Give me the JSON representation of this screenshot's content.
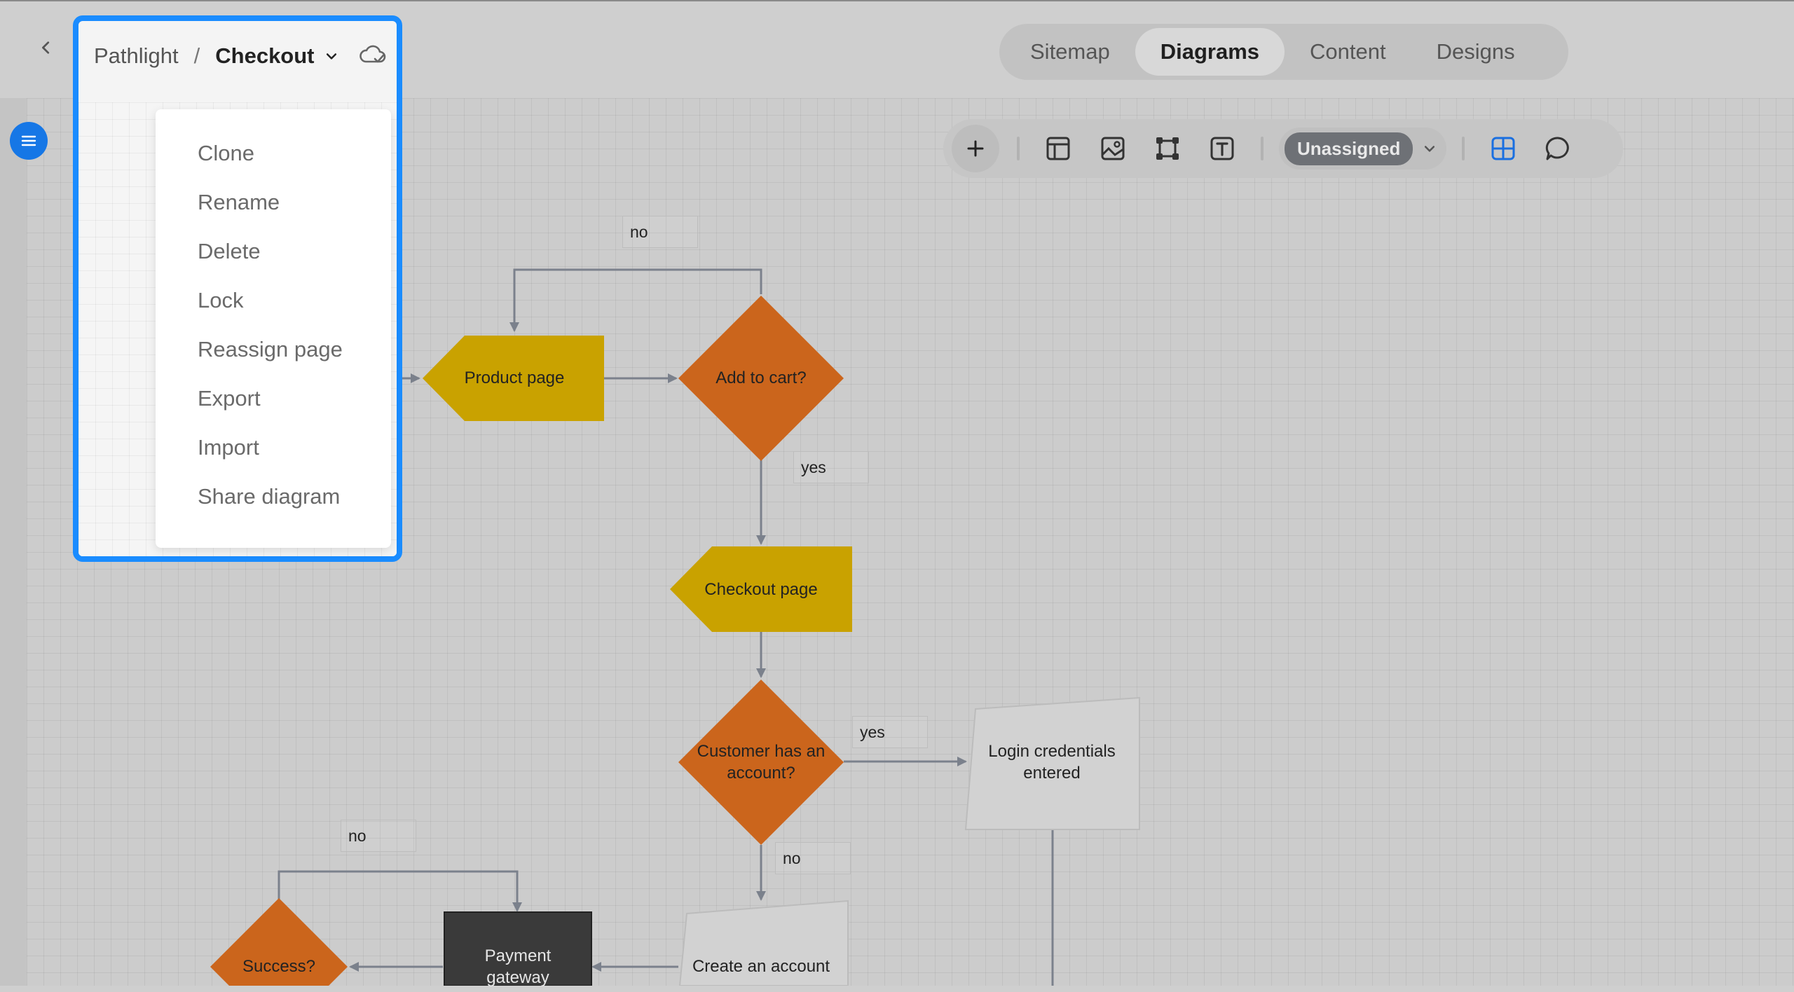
{
  "header": {
    "project": "Pathlight",
    "separator": "/",
    "page": "Checkout"
  },
  "menu": {
    "items": [
      "Clone",
      "Rename",
      "Delete",
      "Lock",
      "Reassign page",
      "Export",
      "Import",
      "Share diagram"
    ]
  },
  "tabs": [
    {
      "label": "Sitemap",
      "active": false
    },
    {
      "label": "Diagrams",
      "active": true
    },
    {
      "label": "Content",
      "active": false
    },
    {
      "label": "Designs",
      "active": false
    }
  ],
  "toolbar": {
    "assign_label": "Unassigned"
  },
  "diagram": {
    "nodes": {
      "product_page": "Product page",
      "add_to_cart": "Add to cart?",
      "checkout_page": "Checkout page",
      "has_account": "Customer has an account?",
      "login": "Login credentials entered",
      "create_account": "Create an account",
      "payment_gateway": "Payment gateway",
      "success": "Success?"
    },
    "edge_labels": {
      "no_top": "no",
      "yes_cart": "yes",
      "yes_account": "yes",
      "no_account": "no",
      "no_success": "no"
    },
    "colors": {
      "page_node": "#c9a200",
      "decision_node": "#cb651c",
      "process_node": "#3a3a3a",
      "input_node": "#d2d2d2",
      "start_node": "#4a4af0",
      "connector": "#7b818c",
      "highlight": "#1a8cff"
    }
  }
}
